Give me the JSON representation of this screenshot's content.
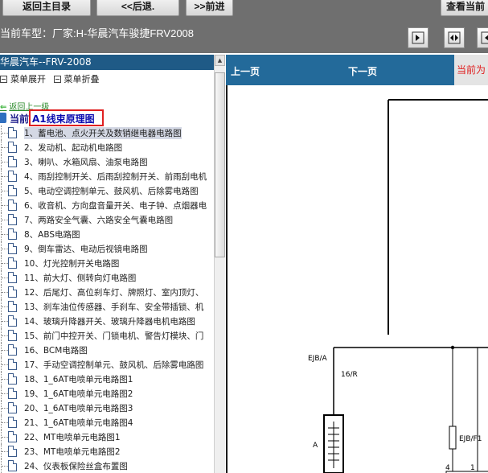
{
  "toolbar": {
    "home_label": "返回主目录",
    "back_label": "<<后退.",
    "forward_label": ">>前进",
    "view_label": "查看当前"
  },
  "vehicle": {
    "label": "当前车型：厂家:H-华晨汽车骏捷FRV2008"
  },
  "tree": {
    "title": "华晨汽车--FRV-2008",
    "expand_label": "菜单展开",
    "collapse_label": "菜单折叠",
    "back_link": "返回上一级",
    "current_label": "当前",
    "current_title": "A1线束原理图",
    "items": [
      {
        "label": "1、蓄电池、点火开关及数销继电器电路图",
        "selected": true
      },
      {
        "label": "2、发动机、起动机电路图"
      },
      {
        "label": "3、喇叭、水箱风扇、油泵电路图"
      },
      {
        "label": "4、雨刮控制开关、后雨刮控制开关、前雨刮电机"
      },
      {
        "label": "5、电动空调控制单元、鼓风机、后除雾电路图"
      },
      {
        "label": "6、收音机、方向盘音量开关、电子钟、点烟器电"
      },
      {
        "label": "7、两路安全气囊、六路安全气囊电路图"
      },
      {
        "label": "8、ABS电路图"
      },
      {
        "label": "9、倒车雷达、电动后视镜电路图"
      },
      {
        "label": "10、灯光控制开关电路图"
      },
      {
        "label": "11、前大灯、侧转向灯电路图"
      },
      {
        "label": "12、后尾灯、高位刹车灯、牌照灯、室内顶灯、"
      },
      {
        "label": "13、刹车油位传感器、手刹车、安全带插锁、机"
      },
      {
        "label": "14、玻璃升降器开关、玻璃升降器电机电路图"
      },
      {
        "label": "15、前门中控开关、门锁电机、警告灯模块、门"
      },
      {
        "label": "16、BCM电路图"
      },
      {
        "label": "17、手动空调控制单元、鼓风机、后除雾电路图"
      },
      {
        "label": "18、1_6AT电喷单元电路图1"
      },
      {
        "label": "19、1_6AT电喷单元电路图2"
      },
      {
        "label": "20、1_6AT电喷单元电路图3"
      },
      {
        "label": "21、1_6AT电喷单元电路图4"
      },
      {
        "label": "22、MT电喷单元电路图1"
      },
      {
        "label": "23、MT电喷单元电路图2"
      },
      {
        "label": "24、仪表板保险丝盒布置图"
      }
    ]
  },
  "diagram_nav": {
    "prev_label": "上一页",
    "next_label": "下一页",
    "current_label": "当前为"
  },
  "diagram": {
    "ejb_a_label": "EJB/A",
    "wire_label": "16/R",
    "battery_label": "A",
    "fuse_label": "EJB/F1",
    "pin_left": "4",
    "pin_right": "1"
  }
}
